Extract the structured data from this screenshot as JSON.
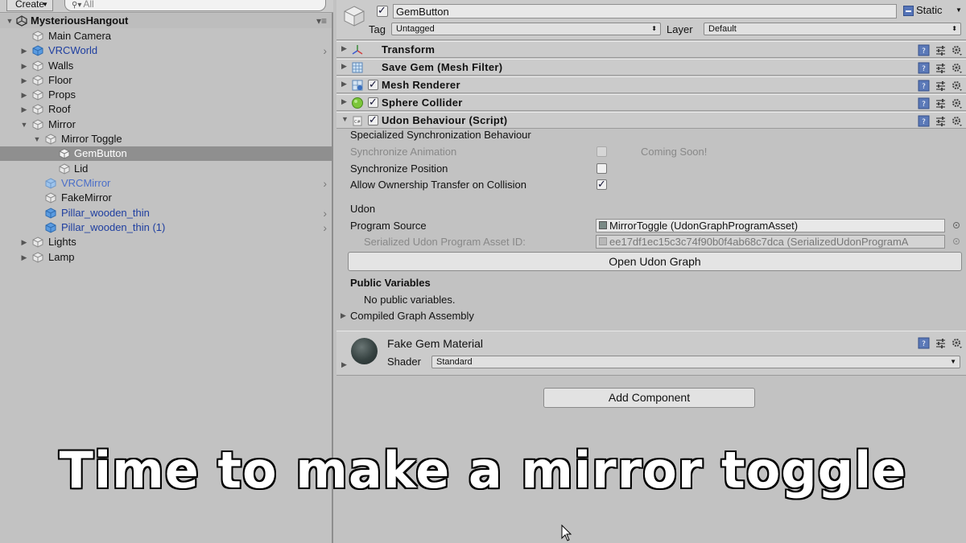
{
  "hierarchy": {
    "create_label": "Create",
    "search_placeholder": "All",
    "scene_name": "MysteriousHangout",
    "items": [
      {
        "label": "Main Camera"
      },
      {
        "label": "VRCWorld"
      },
      {
        "label": "Walls"
      },
      {
        "label": "Floor"
      },
      {
        "label": "Props"
      },
      {
        "label": "Roof"
      },
      {
        "label": "Mirror"
      },
      {
        "label": "Mirror Toggle"
      },
      {
        "label": "GemButton"
      },
      {
        "label": "Lid"
      },
      {
        "label": "VRCMirror"
      },
      {
        "label": "FakeMirror"
      },
      {
        "label": "Pillar_wooden_thin"
      },
      {
        "label": "Pillar_wooden_thin (1)"
      },
      {
        "label": "Lights"
      },
      {
        "label": "Lamp"
      }
    ]
  },
  "inspector": {
    "object_name": "GemButton",
    "static_label": "Static",
    "tag_label": "Tag",
    "tag_value": "Untagged",
    "layer_label": "Layer",
    "layer_value": "Default",
    "components": [
      {
        "title": "Transform"
      },
      {
        "title": "Save Gem (Mesh Filter)"
      },
      {
        "title": "Mesh Renderer"
      },
      {
        "title": "Sphere Collider"
      },
      {
        "title": "Udon Behaviour (Script)"
      }
    ],
    "udon": {
      "sync_header": "Specialized Synchronization Behaviour",
      "sync_animation": "Synchronize Animation",
      "coming_soon": "Coming Soon!",
      "sync_position": "Synchronize Position",
      "allow_ownership": "Allow Ownership Transfer on Collision",
      "udon_header": "Udon",
      "program_source_label": "Program Source",
      "program_source_value": "MirrorToggle (UdonGraphProgramAsset)",
      "serialized_label": "Serialized Udon Program Asset ID:",
      "serialized_value": "ee17df1ec15c3c74f90b0f4ab68c7dca (SerializedUdonProgramA",
      "open_graph_label": "Open Udon Graph",
      "public_vars_header": "Public Variables",
      "no_public_vars": "No public variables.",
      "compiled_assembly": "Compiled Graph Assembly"
    },
    "material": {
      "name": "Fake Gem Material",
      "shader_label": "Shader",
      "shader_value": "Standard"
    },
    "add_component_label": "Add Component"
  },
  "caption": "Time to make a mirror toggle"
}
